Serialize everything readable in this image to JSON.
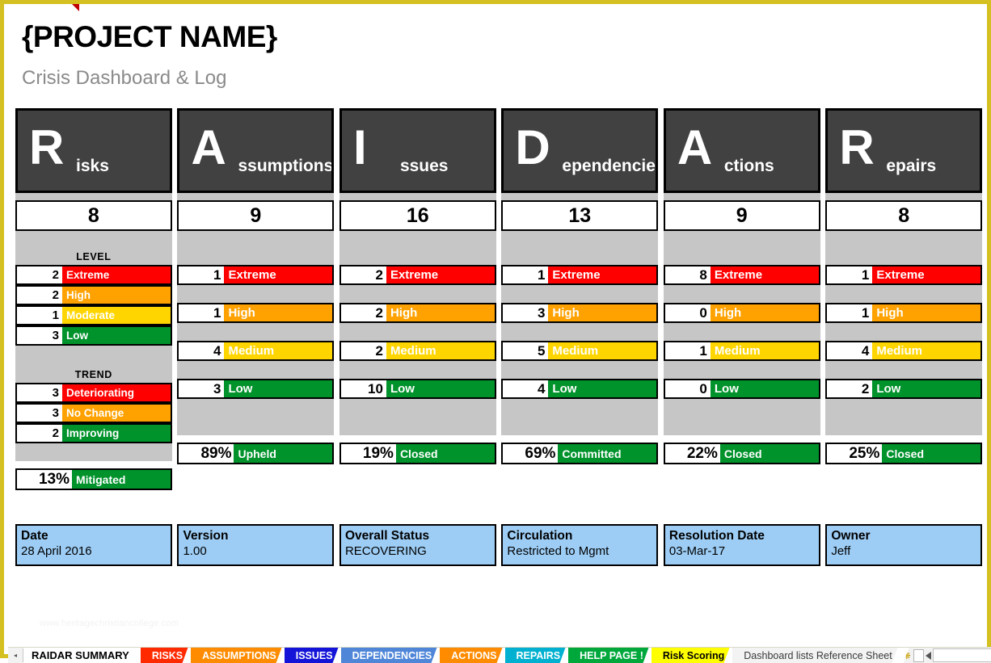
{
  "header": {
    "title": "{PROJECT NAME}",
    "subtitle": "Crisis Dashboard & Log"
  },
  "watermark": "www.heritagechristiancollege.com",
  "labels": {
    "level": "LEVEL",
    "trend": "TREND"
  },
  "colors": {
    "extreme": "#ff0000",
    "high": "#ffa200",
    "moderate": "#ffd500",
    "medium": "#ffd500",
    "low": "#00922b",
    "deteriorating": "#ff0000",
    "no_change": "#ffa200",
    "improving": "#00922b",
    "header_card": "#414141",
    "spacer": "#c6c6c6",
    "info_box": "#9dcdf5",
    "page_border": "#d4c020"
  },
  "columns": [
    {
      "initial": "R",
      "rest": "isks",
      "name": "Risks",
      "count": "8",
      "level_heading": "LEVEL",
      "levels": [
        {
          "value": "2",
          "label": "Extreme",
          "cls": "c-extreme"
        },
        {
          "value": "2",
          "label": "High",
          "cls": "c-high"
        },
        {
          "value": "1",
          "label": "Moderate",
          "cls": "c-moderate"
        },
        {
          "value": "3",
          "label": "Low",
          "cls": "c-low"
        }
      ],
      "trend_heading": "TREND",
      "trends": [
        {
          "value": "3",
          "label": "Deteriorating",
          "cls": "c-deteriorating"
        },
        {
          "value": "3",
          "label": "No Change",
          "cls": "c-nochange"
        },
        {
          "value": "2",
          "label": "Improving",
          "cls": "c-improving"
        }
      ],
      "percent": "13%",
      "percent_label": "Mitigated"
    },
    {
      "initial": "A",
      "rest": "ssumptions",
      "name": "Assumptions",
      "count": "9",
      "levels": [
        {
          "value": "1",
          "label": "Extreme",
          "cls": "c-extreme"
        },
        {
          "value": "1",
          "label": "High",
          "cls": "c-high"
        },
        {
          "value": "4",
          "label": "Medium",
          "cls": "c-medium"
        },
        {
          "value": "3",
          "label": "Low",
          "cls": "c-low"
        }
      ],
      "percent": "89%",
      "percent_label": "Upheld"
    },
    {
      "initial": "I",
      "rest": "ssues",
      "name": "Issues",
      "count": "16",
      "levels": [
        {
          "value": "2",
          "label": "Extreme",
          "cls": "c-extreme"
        },
        {
          "value": "2",
          "label": "High",
          "cls": "c-high"
        },
        {
          "value": "2",
          "label": "Medium",
          "cls": "c-medium"
        },
        {
          "value": "10",
          "label": "Low",
          "cls": "c-low"
        }
      ],
      "percent": "19%",
      "percent_label": "Closed"
    },
    {
      "initial": "D",
      "rest": "ependencies",
      "name": "Dependencies",
      "count": "13",
      "levels": [
        {
          "value": "1",
          "label": "Extreme",
          "cls": "c-extreme"
        },
        {
          "value": "3",
          "label": "High",
          "cls": "c-high"
        },
        {
          "value": "5",
          "label": "Medium",
          "cls": "c-medium"
        },
        {
          "value": "4",
          "label": "Low",
          "cls": "c-low"
        }
      ],
      "percent": "69%",
      "percent_label": "Committed"
    },
    {
      "initial": "A",
      "rest": "ctions",
      "name": "Actions",
      "count": "9",
      "levels": [
        {
          "value": "8",
          "label": "Extreme",
          "cls": "c-extreme"
        },
        {
          "value": "0",
          "label": "High",
          "cls": "c-high"
        },
        {
          "value": "1",
          "label": "Medium",
          "cls": "c-medium"
        },
        {
          "value": "0",
          "label": "Low",
          "cls": "c-low"
        }
      ],
      "percent": "22%",
      "percent_label": "Closed"
    },
    {
      "initial": "R",
      "rest": "epairs",
      "name": "Repairs",
      "count": "8",
      "levels": [
        {
          "value": "1",
          "label": "Extreme",
          "cls": "c-extreme"
        },
        {
          "value": "1",
          "label": "High",
          "cls": "c-high"
        },
        {
          "value": "4",
          "label": "Medium",
          "cls": "c-medium"
        },
        {
          "value": "2",
          "label": "Low",
          "cls": "c-low"
        }
      ],
      "percent": "25%",
      "percent_label": "Closed"
    }
  ],
  "info_boxes": [
    {
      "key": "Date",
      "value": "28 April 2016"
    },
    {
      "key": "Version",
      "value": "1.00"
    },
    {
      "key": "Overall Status",
      "value": "RECOVERING"
    },
    {
      "key": "Circulation",
      "value": "Restricted to Mgmt"
    },
    {
      "key": "Resolution Date",
      "value": "03-Mar-17"
    },
    {
      "key": "Owner",
      "value": "Jeff"
    }
  ],
  "tabs": [
    {
      "label": "RAIDAR SUMMARY",
      "color": "#ffffff",
      "text_color": "#000000",
      "active": true
    },
    {
      "label": "RISKS",
      "color": "#ff2a00",
      "text_color": "#ffffff",
      "active": false
    },
    {
      "label": "ASSUMPTIONS",
      "color": "#ff8c00",
      "text_color": "#ffffff",
      "active": false
    },
    {
      "label": "ISSUES",
      "color": "#1414d8",
      "text_color": "#ffffff",
      "active": false
    },
    {
      "label": "DEPENDENCIES",
      "color": "#4f86d8",
      "text_color": "#ffffff",
      "active": false
    },
    {
      "label": "ACTIONS",
      "color": "#ff8c00",
      "text_color": "#ffffff",
      "active": false
    },
    {
      "label": "REPAIRS",
      "color": "#00b0d0",
      "text_color": "#ffffff",
      "active": false
    },
    {
      "label": "HELP PAGE !",
      "color": "#00a83c",
      "text_color": "#ffffff",
      "active": false
    },
    {
      "label": "Risk Scoring",
      "color": "#ffff00",
      "text_color": "#000000",
      "active": false
    },
    {
      "label": "Dashboard lists Reference Sheet",
      "color": "#f3f3f3",
      "text_color": "#3a3a3a",
      "active": false
    }
  ],
  "tabbar": {
    "nav_prev": "◂",
    "new_sheet_icon": "new-sheet-icon"
  }
}
